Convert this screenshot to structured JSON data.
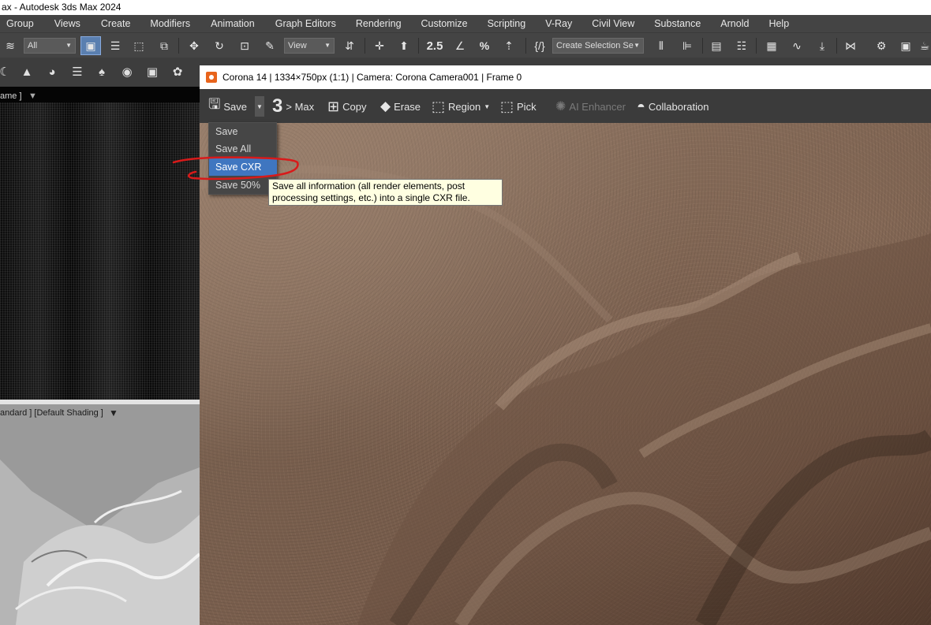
{
  "app": {
    "title": "ax - Autodesk 3ds Max 2024"
  },
  "menubar": {
    "items": [
      "Group",
      "Views",
      "Create",
      "Modifiers",
      "Animation",
      "Graph Editors",
      "Rendering",
      "Customize",
      "Scripting",
      "V-Ray",
      "Civil View",
      "Substance",
      "Arnold",
      "Help"
    ]
  },
  "toolbar": {
    "selection_filter": "All",
    "ref_coord": "View",
    "named_selection": "Create Selection Se",
    "snap_angle_label": "2.5"
  },
  "viewport_top": {
    "label": "ame ]"
  },
  "viewport_bottom": {
    "label": "andard ] [Default Shading ]"
  },
  "vfb": {
    "title": "Corona 14 | 1334×750px (1:1) | Camera: Corona Camera001 | Frame 0",
    "buttons": {
      "save": "Save",
      "to_max_number": "3",
      "to_max": "> Max",
      "copy": "Copy",
      "erase": "Erase",
      "region": "Region",
      "pick": "Pick",
      "ai_enhancer": "AI Enhancer",
      "collaboration": "Collaboration"
    }
  },
  "save_menu": {
    "items": [
      "Save",
      "Save All",
      "Save CXR",
      "Save 50%"
    ],
    "highlighted": "Save CXR"
  },
  "tooltip": {
    "line1": "Save all information (all render elements, post",
    "line2": "processing settings, etc.) into a single CXR file."
  },
  "colors": {
    "highlight": "#3f76c0",
    "annotation": "#d81a1a",
    "tooltip_bg": "#ffffe1"
  }
}
